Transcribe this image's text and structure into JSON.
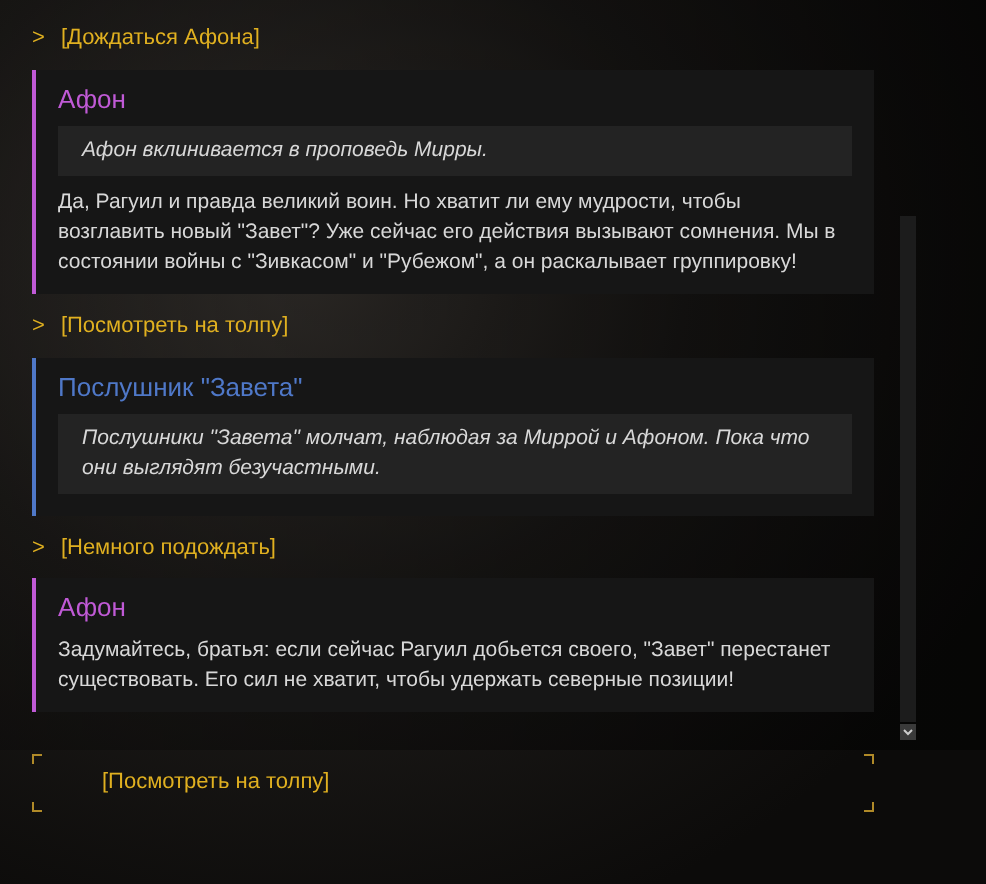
{
  "log": [
    {
      "kind": "choice",
      "marker": ">",
      "text": "[Дождаться Афона]"
    },
    {
      "kind": "speech",
      "speaker": "Афон",
      "color": "#c05ad6",
      "narration": "Афон вклинивается в проповедь Мирры.",
      "line": "Да, Рагуил и правда великий воин. Но хватит ли ему мудрости, чтобы возглавить новый \"Завет\"? Уже сейчас его действия вызывают сомнения. Мы в состоянии войны с \"Зивкасом\" и \"Рубежом\", а он раскалывает группировку!"
    },
    {
      "kind": "choice",
      "marker": ">",
      "text": "[Посмотреть на толпу]"
    },
    {
      "kind": "speech",
      "speaker": "Послушник \"Завета\"",
      "color": "#4f78c8",
      "narration": "Послушники \"Завета\" молчат, наблюдая за Миррой и Афоном. Пока что они выглядят безучастными."
    },
    {
      "kind": "choice",
      "marker": ">",
      "text": "[Немного подождать]"
    },
    {
      "kind": "speech",
      "speaker": "Афон",
      "color": "#c05ad6",
      "line": "Задумайтесь, братья: если сейчас Рагуил добьется своего, \"Завет\" перестанет существовать. Его сил не хватит, чтобы удержать северные позиции!"
    }
  ],
  "options": [
    {
      "text": "[Посмотреть на толпу]"
    }
  ]
}
